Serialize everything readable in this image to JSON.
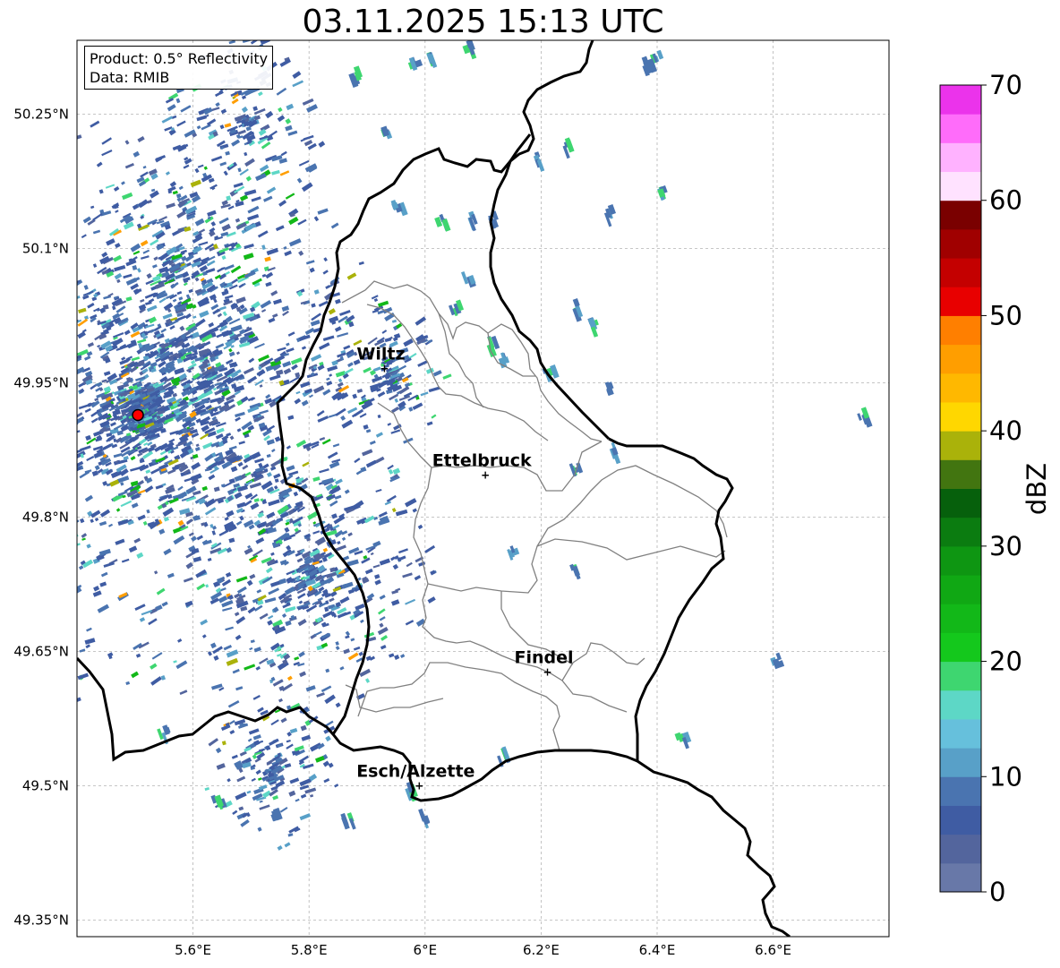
{
  "title": "03.11.2025 15:13 UTC",
  "info": {
    "product": "Product: 0.5° Reflectivity",
    "data": "Data: RMIB"
  },
  "map": {
    "lon_range": [
      5.4,
      6.8
    ],
    "lat_range": [
      49.3,
      50.3
    ],
    "lat_ticks": [
      {
        "value": 50.25,
        "label": "50.25°N"
      },
      {
        "value": 50.1,
        "label": "50.1°N"
      },
      {
        "value": 49.95,
        "label": "49.95°N"
      },
      {
        "value": 49.8,
        "label": "49.8°N"
      },
      {
        "value": 49.65,
        "label": "49.65°N"
      },
      {
        "value": 49.5,
        "label": "49.5°N"
      },
      {
        "value": 49.35,
        "label": "49.35°N"
      }
    ],
    "lon_ticks": [
      {
        "value": 5.6,
        "label": "5.6°E"
      },
      {
        "value": 5.8,
        "label": "5.8°E"
      },
      {
        "value": 6.0,
        "label": "6°E"
      },
      {
        "value": 6.2,
        "label": "6.2°E"
      },
      {
        "value": 6.4,
        "label": "6.4°E"
      },
      {
        "value": 6.6,
        "label": "6.6°E"
      }
    ],
    "cities": [
      {
        "name": "Wiltz",
        "lon": 5.93,
        "lat": 49.966
      },
      {
        "name": "Ettelbruck",
        "lon": 6.104,
        "lat": 49.847
      },
      {
        "name": "Findel",
        "lon": 6.211,
        "lat": 49.627
      },
      {
        "name": "Esch/Alzette",
        "lon": 5.99,
        "lat": 49.5
      }
    ],
    "radar_site": {
      "lon": 5.505,
      "lat": 49.914,
      "color": "#ff0000"
    },
    "grid": true
  },
  "colorbar": {
    "label": "dBZ",
    "min": 0,
    "max": 70,
    "step": 2.5,
    "ticks": [
      {
        "value": 0,
        "label": "0"
      },
      {
        "value": 10,
        "label": "10"
      },
      {
        "value": 20,
        "label": "20"
      },
      {
        "value": 30,
        "label": "30"
      },
      {
        "value": 40,
        "label": "40"
      },
      {
        "value": 50,
        "label": "50"
      },
      {
        "value": 60,
        "label": "60"
      },
      {
        "value": 70,
        "label": "70"
      }
    ],
    "colors": [
      "#6878a8",
      "#53659d",
      "#3f5ca3",
      "#4a74b0",
      "#58a0c8",
      "#66c0dc",
      "#5dd7c6",
      "#3ed670",
      "#14c81c",
      "#12b818",
      "#10a814",
      "#0e9612",
      "#0b7c10",
      "#06600c",
      "#427510",
      "#aab20a",
      "#ffd700",
      "#ffb800",
      "#ff9e00",
      "#ff7f00",
      "#e80000",
      "#c40000",
      "#a00000",
      "#7a0000",
      "#ffe2ff",
      "#ffb2ff",
      "#ff6cfa",
      "#eb33eb"
    ]
  }
}
